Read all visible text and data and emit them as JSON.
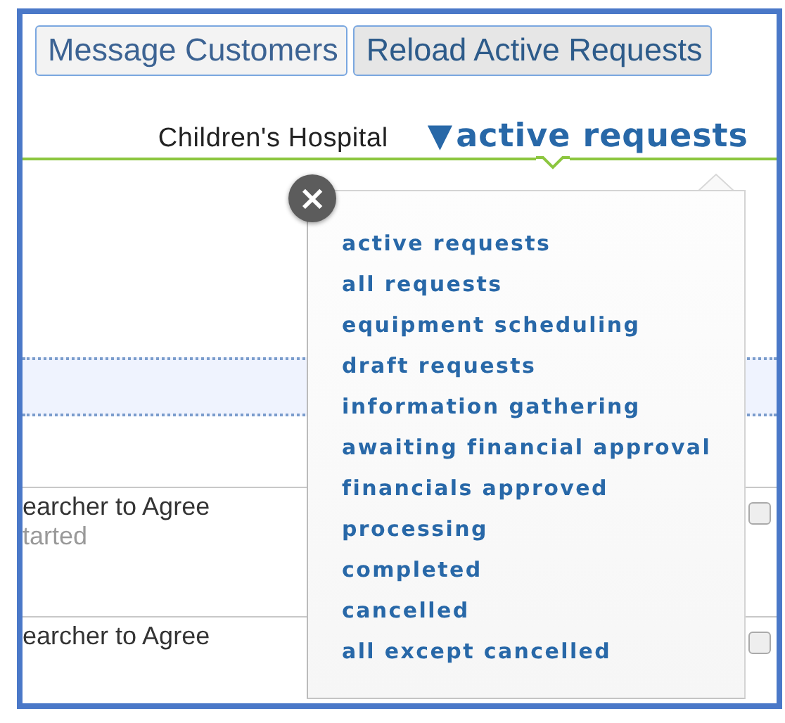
{
  "toolbar": {
    "buttons": [
      {
        "label": "Message Customers",
        "selected": false
      },
      {
        "label": "Reload Active Requests",
        "selected": true
      }
    ]
  },
  "header": {
    "organization": "Children's Hospital",
    "filter_caret": "▼",
    "filter_label": "active requests"
  },
  "rows": [
    {
      "title": "earcher to Agree",
      "status": "tarted",
      "checked": false
    },
    {
      "title": "earcher to Agree",
      "checked": false
    }
  ],
  "filter_menu": {
    "close": "×",
    "items": [
      {
        "label": "active requests"
      },
      {
        "label": "all requests"
      },
      {
        "label": "equipment scheduling"
      },
      {
        "label": "draft requests"
      },
      {
        "label": "information gathering"
      },
      {
        "label": "awaiting financial approval"
      },
      {
        "label": "financials approved"
      },
      {
        "label": "processing"
      },
      {
        "label": "completed"
      },
      {
        "label": "cancelled"
      },
      {
        "label": "all except cancelled"
      }
    ]
  }
}
